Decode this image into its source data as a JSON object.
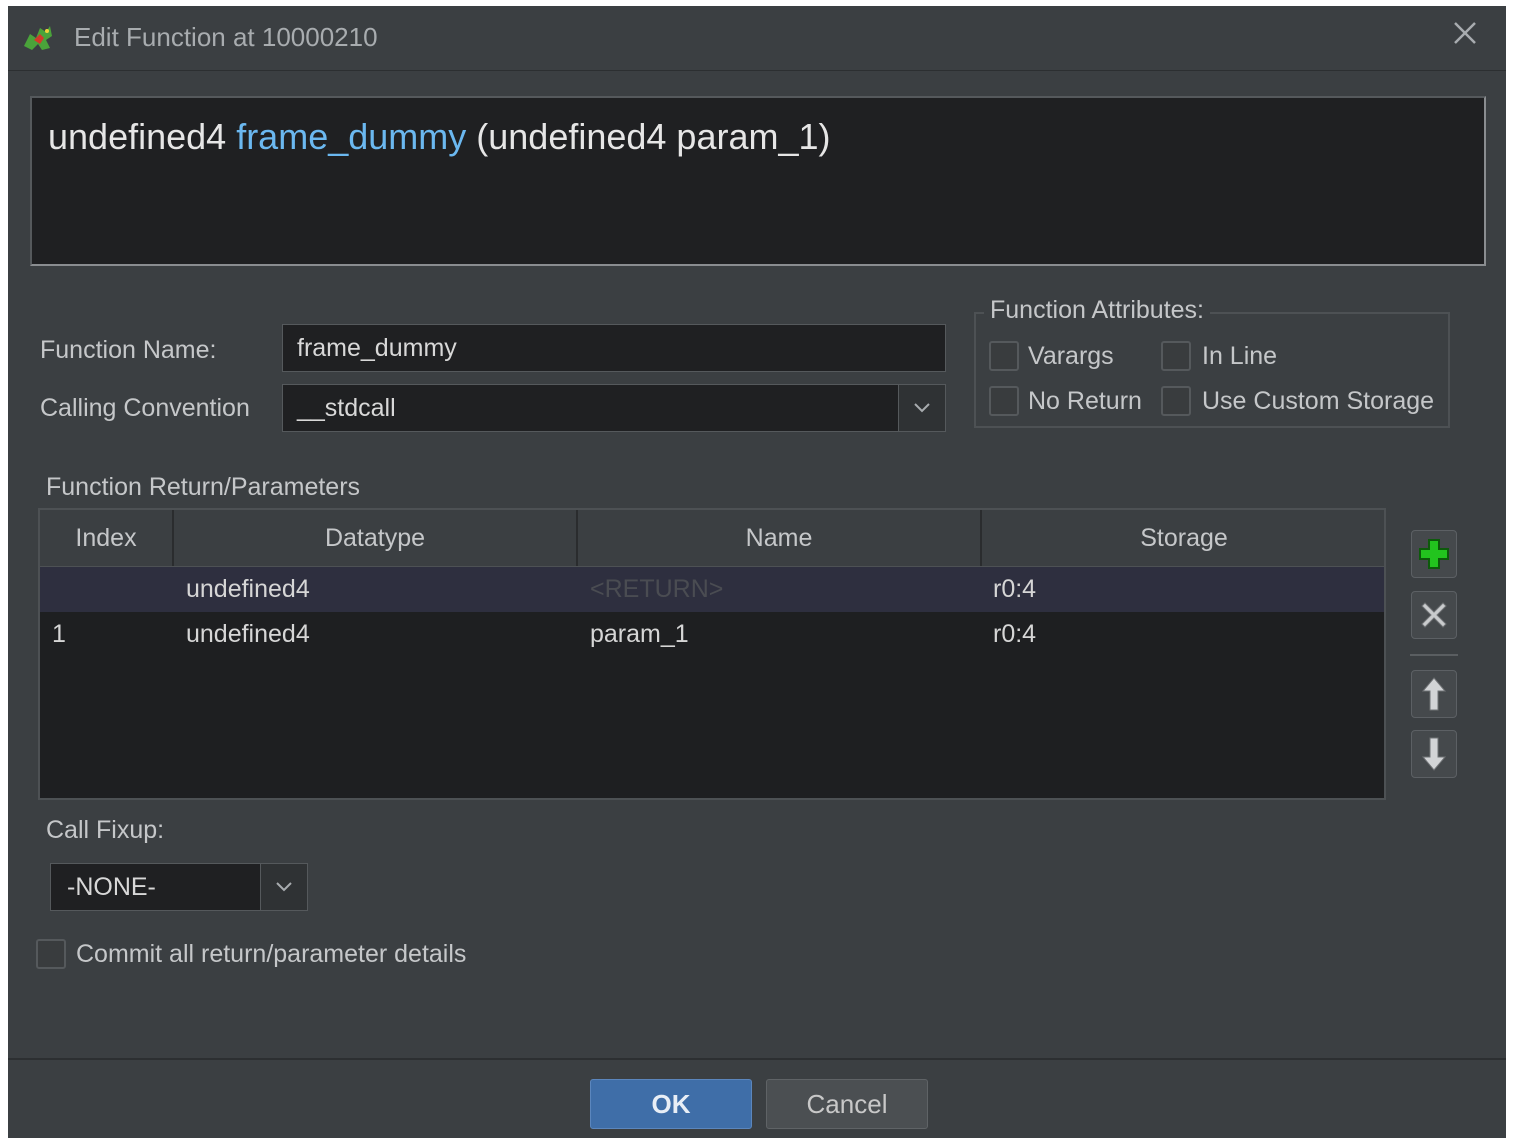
{
  "window": {
    "title": "Edit Function at 10000210",
    "app_icon": "ghidra-dragon-icon",
    "close_icon": "close-icon"
  },
  "signature": {
    "return_type": "undefined4",
    "function_name": "frame_dummy",
    "params": "(undefined4 param_1)",
    "name_color": "#6bb8f0"
  },
  "form": {
    "function_name_label": "Function Name:",
    "function_name_value": "frame_dummy",
    "calling_convention_label": "Calling Convention",
    "calling_convention_value": "__stdcall"
  },
  "attributes": {
    "legend": "Function Attributes:",
    "varargs": {
      "label": "Varargs",
      "checked": false
    },
    "inline": {
      "label": "In Line",
      "checked": false
    },
    "no_return": {
      "label": "No Return",
      "checked": false
    },
    "custom_storage": {
      "label": "Use Custom Storage",
      "checked": false
    }
  },
  "params_table": {
    "section_label": "Function Return/Parameters",
    "columns": [
      "Index",
      "Datatype",
      "Name",
      "Storage"
    ],
    "rows": [
      {
        "index": "",
        "datatype": "undefined4",
        "name": "<RETURN>",
        "storage": "r0:4",
        "selected": true
      },
      {
        "index": "1",
        "datatype": "undefined4",
        "name": "param_1",
        "storage": "r0:4",
        "selected": false
      }
    ]
  },
  "side_buttons": [
    "add-icon",
    "delete-icon",
    "move-up-icon",
    "move-down-icon"
  ],
  "call_fixup": {
    "label": "Call Fixup:",
    "value": "-NONE-"
  },
  "commit": {
    "label": "Commit all return/parameter details",
    "checked": false
  },
  "buttons": {
    "ok": "OK",
    "cancel": "Cancel"
  },
  "colors": {
    "dialog_bg": "#3b3f42",
    "field_bg": "#1f2022",
    "accent_button": "#3f6ea8",
    "add_icon": "#22c41e"
  }
}
